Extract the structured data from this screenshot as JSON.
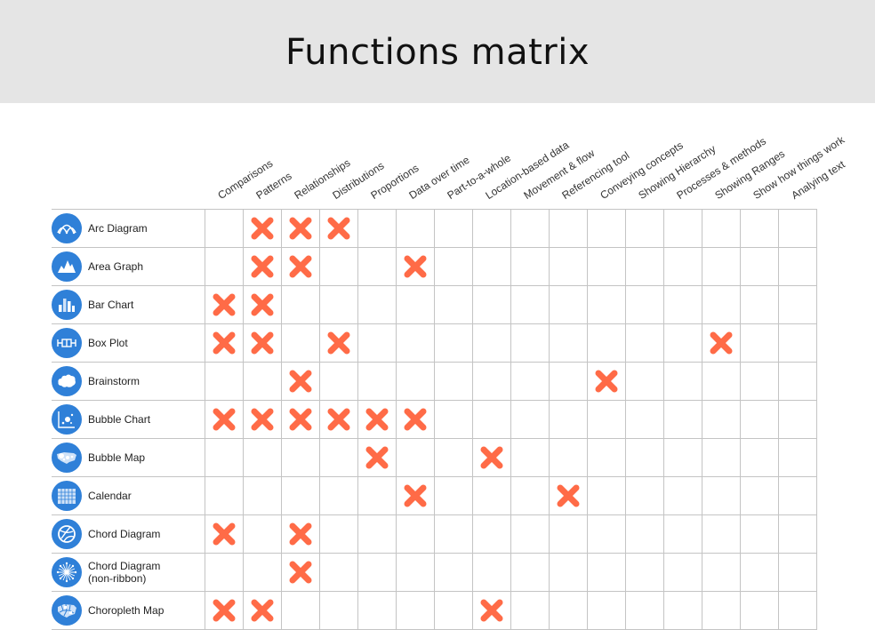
{
  "page": {
    "title": "Functions matrix"
  },
  "colors": {
    "header_band": "#e5e5e5",
    "icon_circle": "#2f80d8",
    "mark": "#ff6b47",
    "grid": "#c4c4c4"
  },
  "columns": [
    "Comparisons",
    "Patterns",
    "Relationships",
    "Distributions",
    "Proportions",
    "Data over time",
    "Part-to-a-whole",
    "Location-based data",
    "Movement & flow",
    "Referencing tool",
    "Conveying concepts",
    "Showing Hierarchy",
    "Processes & methods",
    "Showing Ranges",
    "Show how things work",
    "Analying text"
  ],
  "rows": [
    {
      "name": "Arc Diagram",
      "icon": "arc-diagram-icon",
      "marks": [
        "Patterns",
        "Relationships",
        "Distributions"
      ]
    },
    {
      "name": "Area Graph",
      "icon": "area-graph-icon",
      "marks": [
        "Patterns",
        "Relationships",
        "Data over time"
      ]
    },
    {
      "name": "Bar Chart",
      "icon": "bar-chart-icon",
      "marks": [
        "Comparisons",
        "Patterns"
      ]
    },
    {
      "name": "Box Plot",
      "icon": "box-plot-icon",
      "marks": [
        "Comparisons",
        "Patterns",
        "Distributions",
        "Showing Ranges"
      ]
    },
    {
      "name": "Brainstorm",
      "icon": "brainstorm-icon",
      "marks": [
        "Relationships",
        "Conveying concepts"
      ]
    },
    {
      "name": "Bubble Chart",
      "icon": "bubble-chart-icon",
      "marks": [
        "Comparisons",
        "Patterns",
        "Relationships",
        "Distributions",
        "Proportions",
        "Data over time"
      ]
    },
    {
      "name": "Bubble Map",
      "icon": "bubble-map-icon",
      "marks": [
        "Proportions",
        "Location-based data"
      ]
    },
    {
      "name": "Calendar",
      "icon": "calendar-icon",
      "marks": [
        "Data over time",
        "Referencing tool"
      ]
    },
    {
      "name": "Chord Diagram",
      "icon": "chord-diagram-icon",
      "marks": [
        "Comparisons",
        "Relationships"
      ]
    },
    {
      "name": "Chord Diagram (non-ribbon)",
      "name_lines": [
        "Chord Diagram",
        "(non-ribbon)"
      ],
      "icon": "chord-non-ribbon-icon",
      "marks": [
        "Relationships"
      ]
    },
    {
      "name": "Choropleth Map",
      "icon": "choropleth-map-icon",
      "marks": [
        "Comparisons",
        "Patterns",
        "Location-based data"
      ]
    }
  ]
}
